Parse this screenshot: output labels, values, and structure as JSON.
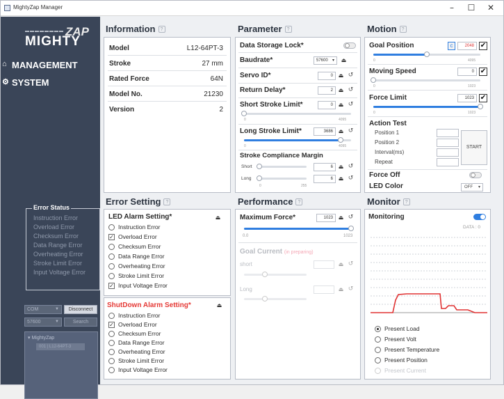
{
  "window": {
    "title": "MightyZap Manager",
    "min": "–",
    "max": "☐",
    "close": "✕"
  },
  "sidebar": {
    "logo_top": "▬▬▬▬▬▬▬▬",
    "logo_main": "MIGHTY",
    "logo_zap": "ZAP",
    "nav": [
      {
        "icon": "⌂",
        "label": "MANAGEMENT"
      },
      {
        "icon": "⚙",
        "label": "SYSTEM"
      }
    ],
    "error_status": {
      "title": "Error Status",
      "items": [
        "Instruction Error",
        "Overload Error",
        "Checksum Error",
        "Data Range Error",
        "Overheating Error",
        "Stroke Limit Error",
        "Input Voltage Error"
      ]
    },
    "port": {
      "com": "COM",
      "disconnect": "Disconnect",
      "baud": "57600",
      "search": "Search",
      "tree_root": "MightyZap",
      "tree_child": "001 | L12-64PT-3"
    }
  },
  "information": {
    "title": "Information",
    "rows": [
      {
        "label": "Model",
        "value": "L12-64PT-3"
      },
      {
        "label": "Stroke",
        "value": "27 mm"
      },
      {
        "label": "Rated Force",
        "value": "64N"
      },
      {
        "label": "Model No.",
        "value": "21230"
      },
      {
        "label": "Version",
        "value": "2"
      }
    ]
  },
  "parameter": {
    "title": "Parameter",
    "data_storage_lock": "Data Storage Lock*",
    "baudrate": {
      "label": "Baudrate*",
      "value": "57600"
    },
    "servo_id": {
      "label": "Servo ID*",
      "value": "0"
    },
    "return_delay": {
      "label": "Return Delay*",
      "value": "2"
    },
    "short_stroke": {
      "label": "Short Stroke Limit*",
      "value": "0",
      "min": "0",
      "max": "4095",
      "level": 0
    },
    "long_stroke": {
      "label": "Long Stroke Limit*",
      "value": "3686",
      "min": "0",
      "max": "4095",
      "level": 0.9
    },
    "compliance": {
      "label": "Stroke Compliance Margin",
      "short_label": "Short",
      "short_value": "6",
      "long_label": "Long",
      "long_value": "6",
      "min": "0",
      "max": "255"
    }
  },
  "motion": {
    "title": "Motion",
    "goal_position": {
      "label": "Goal Position",
      "value": "2048",
      "min": "0",
      "max": "4095",
      "level": 0.5
    },
    "moving_speed": {
      "label": "Moving Speed",
      "value": "0",
      "min": "0",
      "max": "1023",
      "level": 0
    },
    "force_limit": {
      "label": "Force Limit",
      "value": "1023",
      "min": "0",
      "max": "1023",
      "level": 1
    },
    "action_test": {
      "label": "Action Test",
      "position1": "Position 1",
      "position2": "Position 2",
      "interval": "Interval(ms)",
      "repeat": "Repeat",
      "start": "START"
    },
    "force_off": "Force Off",
    "led_color": {
      "label": "LED Color",
      "value": "OFF"
    }
  },
  "error_setting": {
    "title": "Error Setting",
    "led_alarm": {
      "title": "LED Alarm Setting*",
      "items": [
        {
          "label": "Instruction Error",
          "checked": false
        },
        {
          "label": "Overload Error",
          "checked": true
        },
        {
          "label": "Checksum Error",
          "checked": false
        },
        {
          "label": "Data Range Error",
          "checked": false
        },
        {
          "label": "Overheating Error",
          "checked": false
        },
        {
          "label": "Stroke Limit  Error",
          "checked": false
        },
        {
          "label": "Input Voltage Error",
          "checked": true
        }
      ]
    },
    "shutdown_alarm": {
      "title": "ShutDown Alarm Setting*",
      "items": [
        {
          "label": "Instruction Error",
          "checked": false
        },
        {
          "label": "Overload Error",
          "checked": true
        },
        {
          "label": "Checksum Error",
          "checked": false
        },
        {
          "label": "Data Range Error",
          "checked": false
        },
        {
          "label": "Overheating Error",
          "checked": false
        },
        {
          "label": "Stroke Limit  Error",
          "checked": false
        },
        {
          "label": "Input Voltage Error",
          "checked": false
        }
      ]
    }
  },
  "performance": {
    "title": "Performance",
    "max_force": {
      "label": "Maximum Force*",
      "value": "1023",
      "min": "0.0",
      "max": "1023",
      "level": 1
    },
    "goal_current": {
      "label": "Goal Current",
      "note": "(in preparing)",
      "short_label": "short",
      "long_label": "Long"
    }
  },
  "monitor": {
    "title": "Monitor",
    "monitoring": "Monitoring",
    "data_label": "DATA : 0",
    "options": [
      {
        "label": "Present Load",
        "selected": true
      },
      {
        "label": "Present Volt",
        "selected": false
      },
      {
        "label": "Present Temperature",
        "selected": false
      },
      {
        "label": "Present Position",
        "selected": false
      },
      {
        "label": "Present Current",
        "selected": false,
        "disabled": true
      }
    ],
    "trace_color": "#e03030"
  },
  "colors": {
    "accent": "#2f7ee0",
    "sidebar": "#3a4558",
    "shutdown_title": "#e53935"
  },
  "icons": {
    "upload": "⏏",
    "refresh": "↺",
    "checkmark": "✔"
  }
}
